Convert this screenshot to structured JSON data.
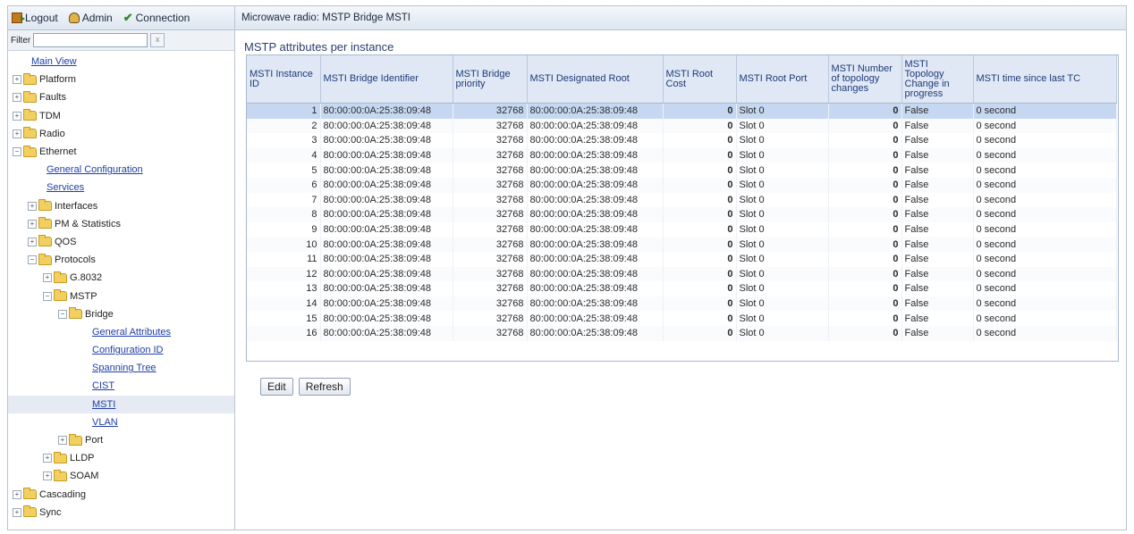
{
  "toolbar": {
    "logout": "Logout",
    "admin": "Admin",
    "connection": "Connection"
  },
  "filter": {
    "label": "Filter",
    "value": "",
    "clear": "x"
  },
  "tree": [
    {
      "label": "Main View",
      "level": 0,
      "link": true
    },
    {
      "label": "Platform",
      "level": 0,
      "folder": true,
      "toggle": "+"
    },
    {
      "label": "Faults",
      "level": 0,
      "folder": true,
      "toggle": "+"
    },
    {
      "label": "TDM",
      "level": 0,
      "folder": true,
      "toggle": "+"
    },
    {
      "label": "Radio",
      "level": 0,
      "folder": true,
      "toggle": "+"
    },
    {
      "label": "Ethernet",
      "level": 0,
      "folder": true,
      "toggle": "−"
    },
    {
      "label": "General Configuration",
      "level": 1,
      "link": true
    },
    {
      "label": "Services",
      "level": 1,
      "link": true
    },
    {
      "label": "Interfaces",
      "level": 1,
      "folder": true,
      "toggle": "+"
    },
    {
      "label": "PM & Statistics",
      "level": 1,
      "folder": true,
      "toggle": "+"
    },
    {
      "label": "QOS",
      "level": 1,
      "folder": true,
      "toggle": "+"
    },
    {
      "label": "Protocols",
      "level": 1,
      "folder": true,
      "toggle": "−"
    },
    {
      "label": "G.8032",
      "level": 2,
      "folder": true,
      "toggle": "+"
    },
    {
      "label": "MSTP",
      "level": 2,
      "folder": true,
      "toggle": "−"
    },
    {
      "label": "Bridge",
      "level": 3,
      "folder": true,
      "toggle": "−"
    },
    {
      "label": "General Attributes",
      "level": 4,
      "link": true
    },
    {
      "label": "Configuration ID",
      "level": 4,
      "link": true
    },
    {
      "label": "Spanning Tree",
      "level": 4,
      "link": true
    },
    {
      "label": "CIST",
      "level": 4,
      "link": true
    },
    {
      "label": "MSTI",
      "level": 4,
      "link": true,
      "selected": true
    },
    {
      "label": "VLAN",
      "level": 4,
      "link": true
    },
    {
      "label": "Port",
      "level": 3,
      "folder": true,
      "toggle": "+"
    },
    {
      "label": "LLDP",
      "level": 2,
      "folder": true,
      "toggle": "+"
    },
    {
      "label": "SOAM",
      "level": 2,
      "folder": true,
      "toggle": "+"
    },
    {
      "label": "Cascading",
      "level": 0,
      "folder": true,
      "toggle": "+"
    },
    {
      "label": "Sync",
      "level": 0,
      "folder": true,
      "toggle": "+"
    }
  ],
  "page": {
    "title": "Microwave radio: MSTP Bridge MSTI",
    "section_title": "MSTP attributes per instance"
  },
  "table": {
    "columns": [
      "MSTI Instance ID",
      "MSTI Bridge Identifier",
      "MSTI Bridge priority",
      "MSTI Designated Root",
      "MSTI Root Cost",
      "MSTI Root Port",
      "MSTI Number of topology changes",
      "MSTI Topology Change in progress",
      "MSTI time since last TC"
    ],
    "selected_row": 0,
    "rows": [
      [
        "1",
        "80:00:00:0A:25:38:09:48",
        "32768",
        "80:00:00:0A:25:38:09:48",
        "0",
        "Slot 0",
        "0",
        "False",
        "0 second"
      ],
      [
        "2",
        "80:00:00:0A:25:38:09:48",
        "32768",
        "80:00:00:0A:25:38:09:48",
        "0",
        "Slot 0",
        "0",
        "False",
        "0 second"
      ],
      [
        "3",
        "80:00:00:0A:25:38:09:48",
        "32768",
        "80:00:00:0A:25:38:09:48",
        "0",
        "Slot 0",
        "0",
        "False",
        "0 second"
      ],
      [
        "4",
        "80:00:00:0A:25:38:09:48",
        "32768",
        "80:00:00:0A:25:38:09:48",
        "0",
        "Slot 0",
        "0",
        "False",
        "0 second"
      ],
      [
        "5",
        "80:00:00:0A:25:38:09:48",
        "32768",
        "80:00:00:0A:25:38:09:48",
        "0",
        "Slot 0",
        "0",
        "False",
        "0 second"
      ],
      [
        "6",
        "80:00:00:0A:25:38:09:48",
        "32768",
        "80:00:00:0A:25:38:09:48",
        "0",
        "Slot 0",
        "0",
        "False",
        "0 second"
      ],
      [
        "7",
        "80:00:00:0A:25:38:09:48",
        "32768",
        "80:00:00:0A:25:38:09:48",
        "0",
        "Slot 0",
        "0",
        "False",
        "0 second"
      ],
      [
        "8",
        "80:00:00:0A:25:38:09:48",
        "32768",
        "80:00:00:0A:25:38:09:48",
        "0",
        "Slot 0",
        "0",
        "False",
        "0 second"
      ],
      [
        "9",
        "80:00:00:0A:25:38:09:48",
        "32768",
        "80:00:00:0A:25:38:09:48",
        "0",
        "Slot 0",
        "0",
        "False",
        "0 second"
      ],
      [
        "10",
        "80:00:00:0A:25:38:09:48",
        "32768",
        "80:00:00:0A:25:38:09:48",
        "0",
        "Slot 0",
        "0",
        "False",
        "0 second"
      ],
      [
        "11",
        "80:00:00:0A:25:38:09:48",
        "32768",
        "80:00:00:0A:25:38:09:48",
        "0",
        "Slot 0",
        "0",
        "False",
        "0 second"
      ],
      [
        "12",
        "80:00:00:0A:25:38:09:48",
        "32768",
        "80:00:00:0A:25:38:09:48",
        "0",
        "Slot 0",
        "0",
        "False",
        "0 second"
      ],
      [
        "13",
        "80:00:00:0A:25:38:09:48",
        "32768",
        "80:00:00:0A:25:38:09:48",
        "0",
        "Slot 0",
        "0",
        "False",
        "0 second"
      ],
      [
        "14",
        "80:00:00:0A:25:38:09:48",
        "32768",
        "80:00:00:0A:25:38:09:48",
        "0",
        "Slot 0",
        "0",
        "False",
        "0 second"
      ],
      [
        "15",
        "80:00:00:0A:25:38:09:48",
        "32768",
        "80:00:00:0A:25:38:09:48",
        "0",
        "Slot 0",
        "0",
        "False",
        "0 second"
      ],
      [
        "16",
        "80:00:00:0A:25:38:09:48",
        "32768",
        "80:00:00:0A:25:38:09:48",
        "0",
        "Slot 0",
        "0",
        "False",
        "0 second"
      ]
    ]
  },
  "buttons": {
    "edit": "Edit",
    "refresh": "Refresh"
  }
}
